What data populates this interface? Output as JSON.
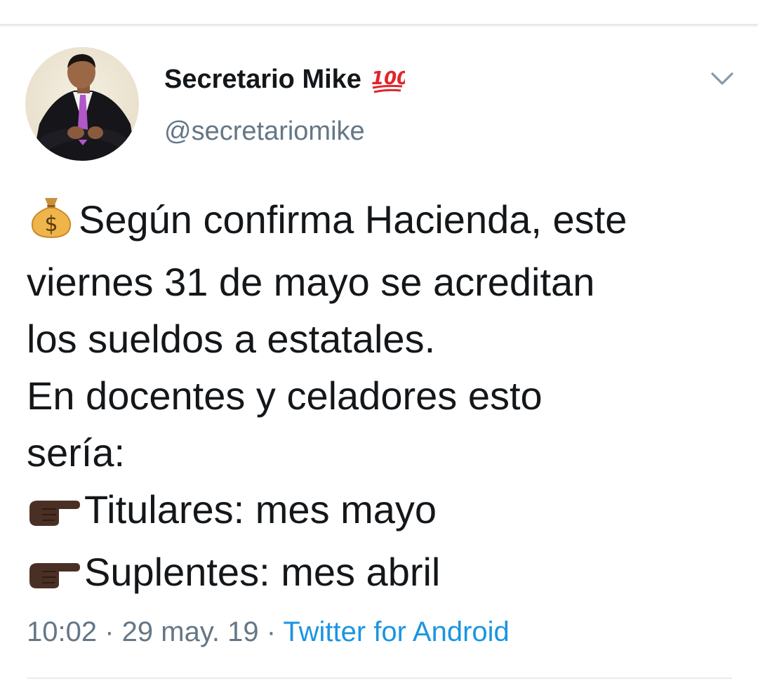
{
  "user": {
    "display_name": "Secretario Mike",
    "name_emoji": "hundred-points-icon",
    "handle": "@secretariomike"
  },
  "tweet": {
    "line1_emoji": "money-bag-icon",
    "line1": "Según confirma Hacienda, este",
    "line2": "viernes 31 de mayo se acreditan",
    "line3": "los sueldos a estatales.",
    "line4": "En docentes y celadores esto",
    "line5": "sería:",
    "line6_emoji": "pointing-right-icon",
    "line6": "Titulares: mes mayo",
    "line7_emoji": "pointing-right-icon",
    "line7": "Suplentes: mes abril"
  },
  "meta": {
    "time": "10:02",
    "sep1": " · ",
    "date": "29 may. 19",
    "sep2": " · ",
    "source": "Twitter for Android"
  },
  "colors": {
    "text": "#14171a",
    "secondary": "#657786",
    "link": "#1b95e0",
    "divider": "#e6ecf0"
  }
}
